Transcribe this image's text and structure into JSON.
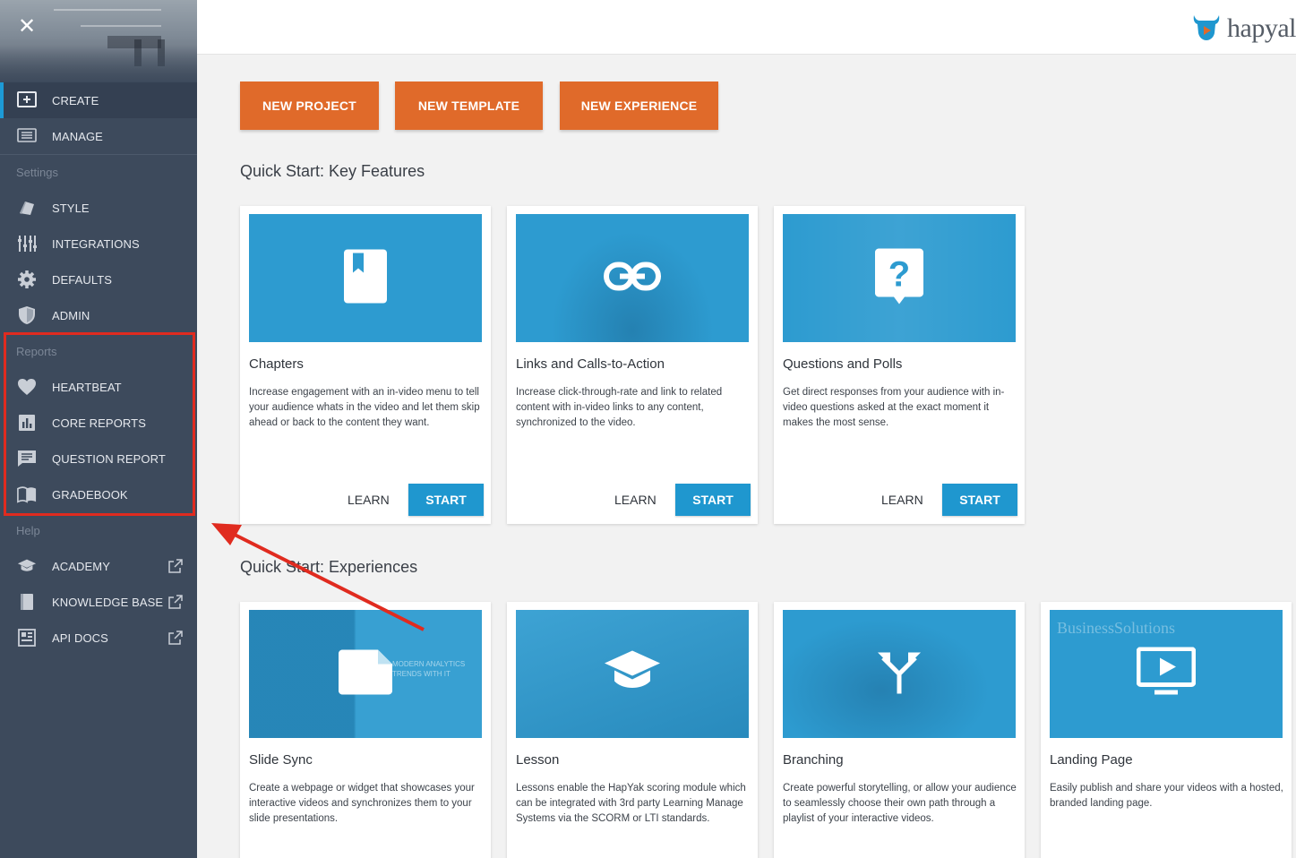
{
  "sidebar": {
    "close_icon": "close-icon",
    "nav": [
      {
        "label": "CREATE",
        "icon": "plus-square-icon"
      },
      {
        "label": "MANAGE",
        "icon": "list-icon"
      }
    ],
    "settings": {
      "heading": "Settings",
      "items": [
        {
          "label": "STYLE",
          "icon": "brush-icon"
        },
        {
          "label": "INTEGRATIONS",
          "icon": "sliders-icon"
        },
        {
          "label": "DEFAULTS",
          "icon": "gear-icon"
        },
        {
          "label": "ADMIN",
          "icon": "shield-icon"
        }
      ]
    },
    "reports": {
      "heading": "Reports",
      "items": [
        {
          "label": "HEARTBEAT",
          "icon": "heart-icon"
        },
        {
          "label": "CORE REPORTS",
          "icon": "bar-chart-icon"
        },
        {
          "label": "QUESTION REPORT",
          "icon": "comment-icon"
        },
        {
          "label": "GRADEBOOK",
          "icon": "book-icon"
        }
      ]
    },
    "help": {
      "heading": "Help",
      "items": [
        {
          "label": "ACADEMY",
          "icon": "graduation-cap-icon"
        },
        {
          "label": "KNOWLEDGE BASE",
          "icon": "book-closed-icon"
        },
        {
          "label": "API DOCS",
          "icon": "code-grid-icon"
        }
      ]
    }
  },
  "header": {
    "logo_text": "hapyal"
  },
  "actions": {
    "new_project": "NEW PROJECT",
    "new_template": "NEW TEMPLATE",
    "new_experience": "NEW EXPERIENCE"
  },
  "key_features": {
    "title": "Quick Start: Key Features",
    "cards": [
      {
        "title": "Chapters",
        "desc": "Increase engagement with an in-video menu to tell your audience whats in the video and let them skip ahead or back to the content they want.",
        "learn": "LEARN",
        "start": "START",
        "icon": "bookmark-icon"
      },
      {
        "title": "Links and Calls-to-Action",
        "desc": "Increase click-through-rate and link to related content with in-video links to any content, synchronized to the video.",
        "learn": "LEARN",
        "start": "START",
        "icon": "link-icon"
      },
      {
        "title": "Questions and Polls",
        "desc": "Get direct responses from your audience with in-video questions asked at the exact moment it makes the most sense.",
        "learn": "LEARN",
        "start": "START",
        "icon": "question-icon"
      }
    ]
  },
  "experiences": {
    "title": "Quick Start: Experiences",
    "cards": [
      {
        "title": "Slide Sync",
        "desc": "Create a webpage or widget that showcases your interactive videos and synchronizes them to your slide presentations.",
        "icon": "slide-icon"
      },
      {
        "title": "Lesson",
        "desc": "Lessons enable the HapYak scoring module which can be integrated with 3rd party Learning Manage Systems via the SCORM or LTI standards.",
        "icon": "graduation-cap-icon"
      },
      {
        "title": "Branching",
        "desc": "Create powerful storytelling, or allow your audience to seamlessly choose their own path through a playlist of your interactive videos.",
        "icon": "branch-icon"
      },
      {
        "title": "Landing Page",
        "desc": "Easily publish and share your videos with a hosted, branded landing page.",
        "icon": "play-screen-icon"
      }
    ],
    "thumb_texts": {
      "slide_sync": "MODERN ANALYTICS TRENDS WITH IT",
      "landing_page": "BusinessSolutions"
    }
  },
  "colors": {
    "sidebar_bg": "#3d4a5c",
    "accent_orange": "#e06a2a",
    "accent_blue": "#1f97cf",
    "thumb_blue": "#2d9bd0",
    "highlight_red": "#e02b1f"
  }
}
